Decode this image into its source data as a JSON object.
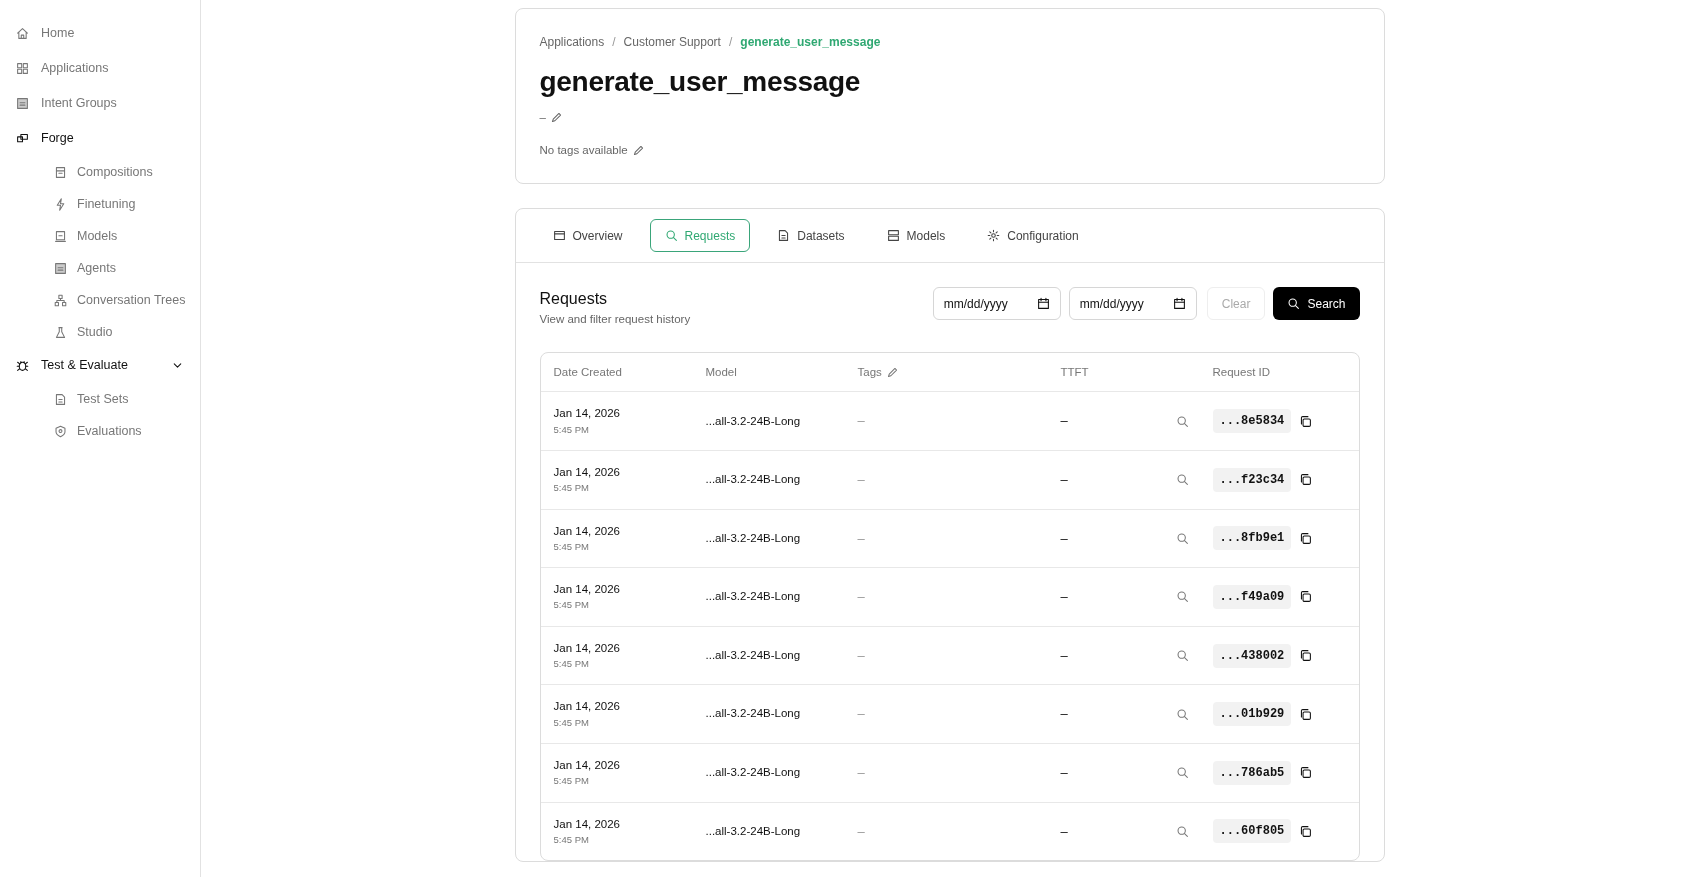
{
  "sidebar": {
    "items": [
      {
        "label": "Home"
      },
      {
        "label": "Applications"
      },
      {
        "label": "Intent Groups"
      },
      {
        "label": "Forge",
        "children": [
          {
            "label": "Compositions"
          },
          {
            "label": "Finetuning"
          },
          {
            "label": "Models"
          },
          {
            "label": "Agents"
          },
          {
            "label": "Conversation Trees"
          },
          {
            "label": "Studio"
          }
        ]
      },
      {
        "label": "Test & Evaluate",
        "expanded": true,
        "children": [
          {
            "label": "Test Sets"
          },
          {
            "label": "Evaluations"
          }
        ]
      }
    ]
  },
  "breadcrumb": [
    {
      "label": "Applications",
      "current": false
    },
    {
      "separator": "/",
      "label": "Customer Support",
      "current": false
    },
    {
      "separator": "/",
      "label": "generate_user_message",
      "current": true
    }
  ],
  "title": "generate_user_message",
  "description": "–",
  "tags_text": "No tags available",
  "tabs": [
    {
      "label": "Overview",
      "selected": false
    },
    {
      "label": "Requests",
      "selected": true
    },
    {
      "label": "Datasets",
      "selected": false
    },
    {
      "label": "Models",
      "selected": false
    },
    {
      "label": "Configuration",
      "selected": false
    }
  ],
  "section": {
    "title": "Requests",
    "subtitle": "View and filter request history"
  },
  "filters": {
    "date_from": {
      "placeholder": "mm/dd/yyyy"
    },
    "date_to": {
      "placeholder": "mm/dd/yyyy"
    },
    "clear": "Clear",
    "search": "Search"
  },
  "table": {
    "columns": [
      "Date Created",
      "Model",
      "Tags",
      "TTFT",
      "Request ID"
    ],
    "rows": [
      {
        "date": "Jan 14, 2026",
        "time": "5:45 PM",
        "model": "...all-3.2-24B-Long",
        "tags": "–",
        "ttft": "–",
        "request_id": "...8e5834"
      },
      {
        "date": "Jan 14, 2026",
        "time": "5:45 PM",
        "model": "...all-3.2-24B-Long",
        "tags": "–",
        "ttft": "–",
        "request_id": "...f23c34"
      },
      {
        "date": "Jan 14, 2026",
        "time": "5:45 PM",
        "model": "...all-3.2-24B-Long",
        "tags": "–",
        "ttft": "–",
        "request_id": "...8fb9e1"
      },
      {
        "date": "Jan 14, 2026",
        "time": "5:45 PM",
        "model": "...all-3.2-24B-Long",
        "tags": "–",
        "ttft": "–",
        "request_id": "...f49a09"
      },
      {
        "date": "Jan 14, 2026",
        "time": "5:45 PM",
        "model": "...all-3.2-24B-Long",
        "tags": "–",
        "ttft": "–",
        "request_id": "...438002"
      },
      {
        "date": "Jan 14, 2026",
        "time": "5:45 PM",
        "model": "...all-3.2-24B-Long",
        "tags": "–",
        "ttft": "–",
        "request_id": "...01b929"
      },
      {
        "date": "Jan 14, 2026",
        "time": "5:45 PM",
        "model": "...all-3.2-24B-Long",
        "tags": "–",
        "ttft": "–",
        "request_id": "...786ab5"
      },
      {
        "date": "Jan 14, 2026",
        "time": "5:45 PM",
        "model": "...all-3.2-24B-Long",
        "tags": "–",
        "ttft": "–",
        "request_id": "...60f805"
      }
    ]
  }
}
